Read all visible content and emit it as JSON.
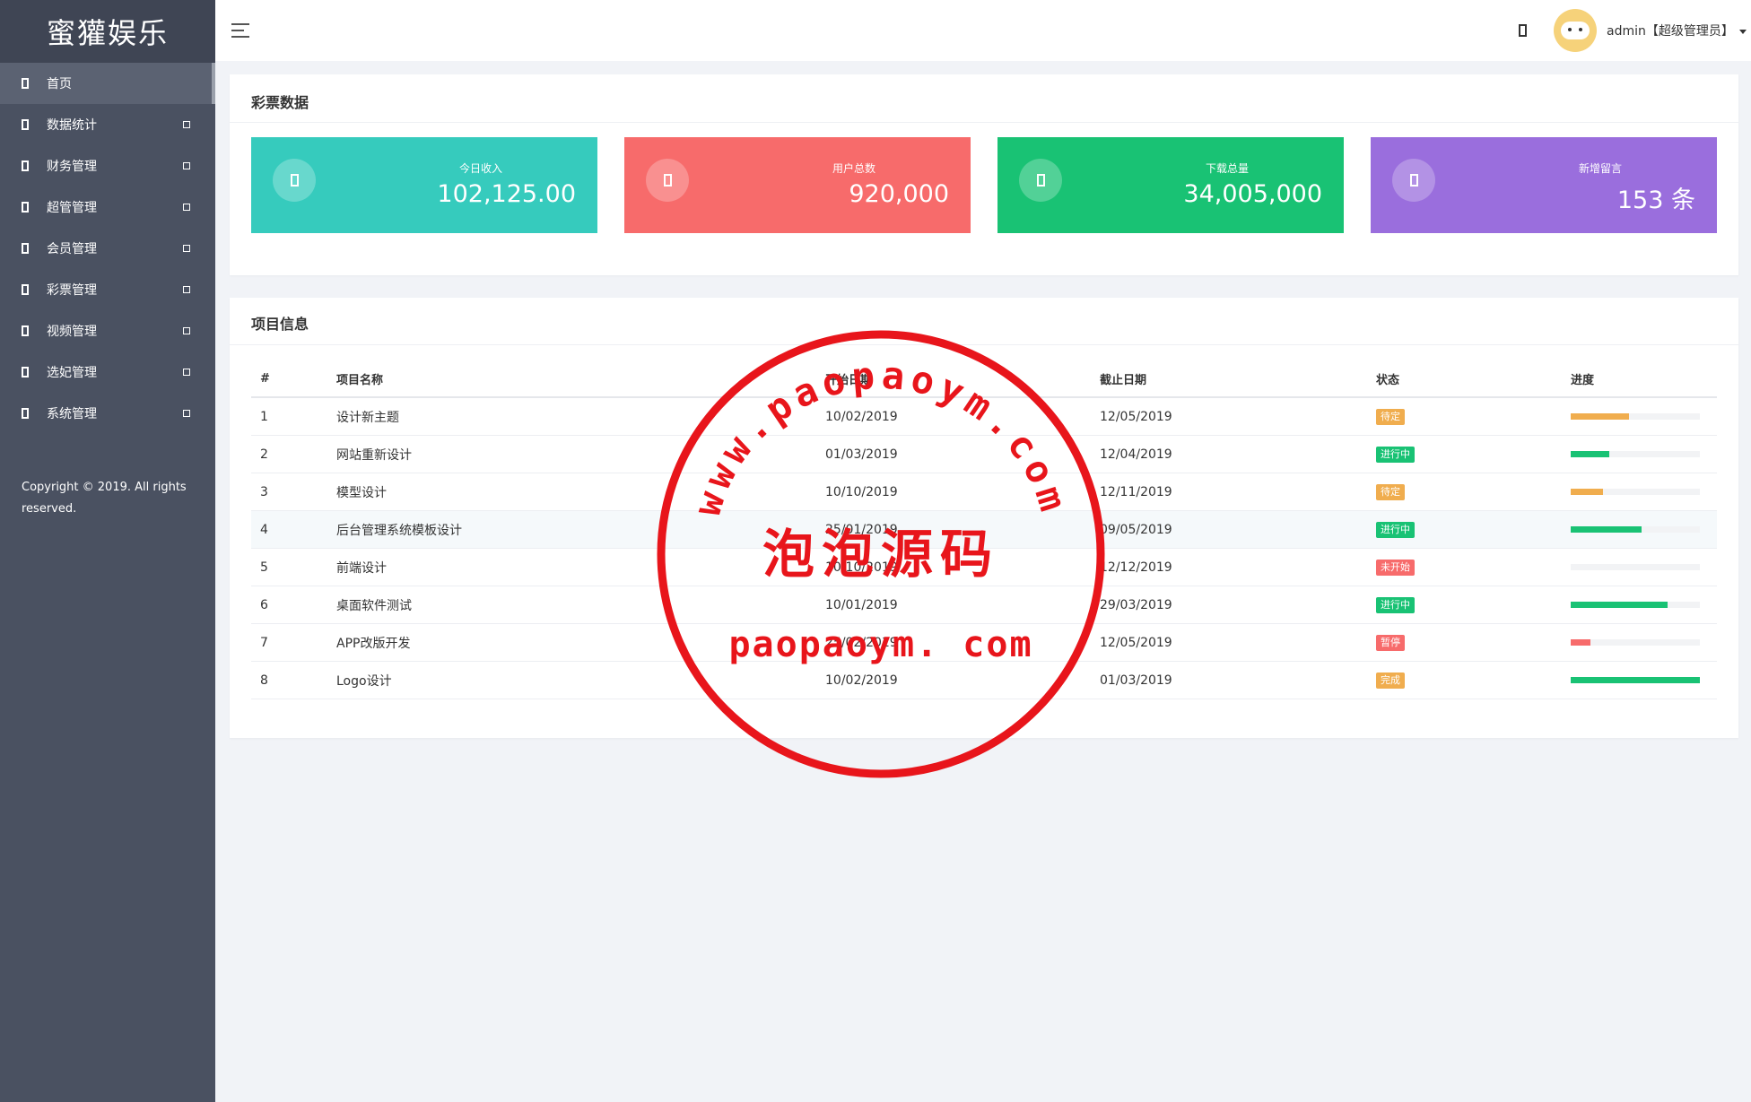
{
  "app": {
    "brand": "蜜獾娱乐",
    "copyright": "Copyright © 2019. All rights reserved."
  },
  "sidebar": {
    "items": [
      {
        "label": "首页",
        "active": true
      },
      {
        "label": "数据统计"
      },
      {
        "label": "财务管理"
      },
      {
        "label": "超管管理"
      },
      {
        "label": "会员管理"
      },
      {
        "label": "彩票管理"
      },
      {
        "label": "视频管理"
      },
      {
        "label": "选妃管理"
      },
      {
        "label": "系统管理"
      }
    ]
  },
  "header": {
    "user": "admin【超级管理员】"
  },
  "stats_panel": {
    "title": "彩票数据",
    "cards": [
      {
        "label": "今日收入",
        "value": "102,125.00",
        "color": "#36cbbd"
      },
      {
        "label": "用户总数",
        "value": "920,000",
        "color": "#f76b6b"
      },
      {
        "label": "下载总量",
        "value": "34,005,000",
        "color": "#19c274"
      },
      {
        "label": "新增留言",
        "value": "153 条",
        "color": "#9a6edd"
      }
    ]
  },
  "projects_panel": {
    "title": "项目信息",
    "columns": [
      "#",
      "项目名称",
      "开始日期",
      "截止日期",
      "状态",
      "进度"
    ],
    "rows": [
      {
        "id": "1",
        "name": "设计新主题",
        "start": "10/02/2019",
        "end": "12/05/2019",
        "status": "待定",
        "status_color": "#f0ad4e",
        "progress": 45,
        "progress_color": "#f0ad4e"
      },
      {
        "id": "2",
        "name": "网站重新设计",
        "start": "01/03/2019",
        "end": "12/04/2019",
        "status": "进行中",
        "status_color": "#19c274",
        "progress": 30,
        "progress_color": "#19c274"
      },
      {
        "id": "3",
        "name": "模型设计",
        "start": "10/10/2019",
        "end": "12/11/2019",
        "status": "待定",
        "status_color": "#f0ad4e",
        "progress": 25,
        "progress_color": "#f0ad4e"
      },
      {
        "id": "4",
        "name": "后台管理系统模板设计",
        "start": "25/01/2019",
        "end": "09/05/2019",
        "status": "进行中",
        "status_color": "#19c274",
        "progress": 55,
        "progress_color": "#19c274",
        "highlight": true
      },
      {
        "id": "5",
        "name": "前端设计",
        "start": "10/10/2019",
        "end": "12/12/2019",
        "status": "未开始",
        "status_color": "#f76b6b",
        "progress": 0,
        "progress_color": "#f76b6b"
      },
      {
        "id": "6",
        "name": "桌面软件测试",
        "start": "10/01/2019",
        "end": "29/03/2019",
        "status": "进行中",
        "status_color": "#19c274",
        "progress": 75,
        "progress_color": "#19c274"
      },
      {
        "id": "7",
        "name": "APP改版开发",
        "start": "25/02/2019",
        "end": "12/05/2019",
        "status": "暂停",
        "status_color": "#f76b6b",
        "progress": 15,
        "progress_color": "#f76b6b"
      },
      {
        "id": "8",
        "name": "Logo设计",
        "start": "10/02/2019",
        "end": "01/03/2019",
        "status": "完成",
        "status_color": "#f0ad4e",
        "progress": 100,
        "progress_color": "#19c274"
      }
    ]
  },
  "watermark": {
    "arc_text": "www.paopaoym.com",
    "center_text": "泡泡源码",
    "bottom_text": "paopaoym. com"
  }
}
